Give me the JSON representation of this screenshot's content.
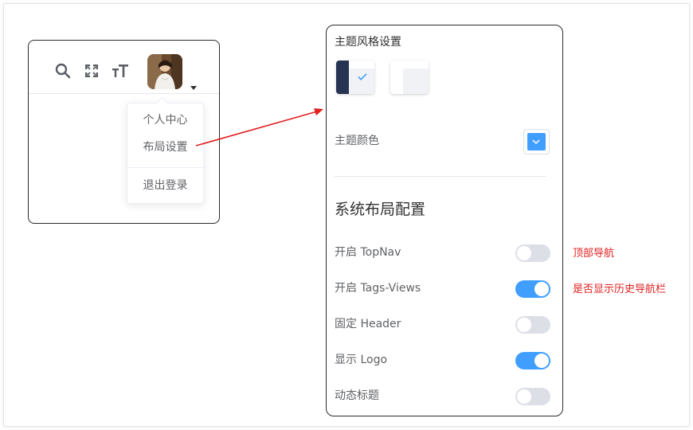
{
  "navbar": {
    "search_icon": "search-icon",
    "fullscreen_icon": "fullscreen-icon",
    "font_size_icon": "font-size-icon",
    "avatar_caret_icon": "caret-down-icon",
    "dropdown": {
      "items": [
        "个人中心",
        "布局设置",
        "退出登录"
      ]
    }
  },
  "settings": {
    "theme_style_title": "主题风格设置",
    "theme_options": [
      {
        "name": "theme-dark",
        "selected": true
      },
      {
        "name": "theme-light",
        "selected": false
      }
    ],
    "theme_color_label": "主题颜色",
    "theme_color_value": "#409eff",
    "layout_heading": "系统布局配置",
    "rows": [
      {
        "label": "开启 TopNav",
        "enabled": false
      },
      {
        "label": "开启 Tags-Views",
        "enabled": true
      },
      {
        "label": "固定 Header",
        "enabled": false
      },
      {
        "label": "显示 Logo",
        "enabled": true
      },
      {
        "label": "动态标题",
        "enabled": false
      }
    ]
  },
  "annotations": {
    "topnav_note": "顶部导航",
    "tagsviews_note": "是否显示历史导航栏"
  },
  "colors": {
    "accent": "#409eff",
    "annotation_red": "#e02020",
    "theme_dark_sidebar": "#273352"
  }
}
